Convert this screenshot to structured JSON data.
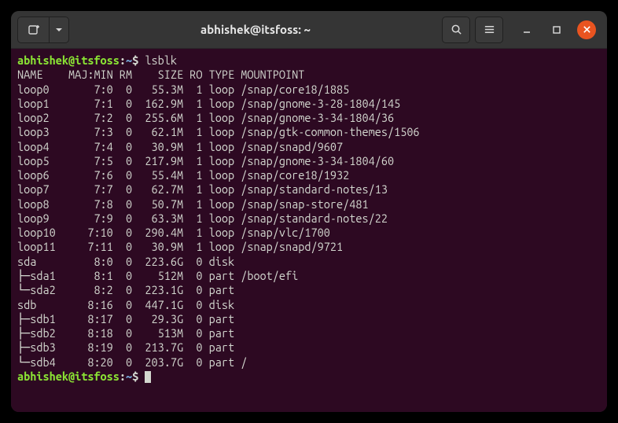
{
  "window": {
    "title": "abhishek@itsfoss: ~"
  },
  "prompt": {
    "userhost": "abhishek@itsfoss",
    "sep": ":",
    "path": "~",
    "sigil": "$"
  },
  "command": "lsblk",
  "header": {
    "name": "NAME",
    "majmin": "MAJ:MIN",
    "rm": "RM",
    "size": "SIZE",
    "ro": "RO",
    "type": "TYPE",
    "mountpoint": "MOUNTPOINT"
  },
  "rows": [
    {
      "prefix": "",
      "name": "loop0",
      "majmin": "7:0",
      "rm": "0",
      "size": "55.3M",
      "ro": "1",
      "type": "loop",
      "mountpoint": "/snap/core18/1885"
    },
    {
      "prefix": "",
      "name": "loop1",
      "majmin": "7:1",
      "rm": "0",
      "size": "162.9M",
      "ro": "1",
      "type": "loop",
      "mountpoint": "/snap/gnome-3-28-1804/145"
    },
    {
      "prefix": "",
      "name": "loop2",
      "majmin": "7:2",
      "rm": "0",
      "size": "255.6M",
      "ro": "1",
      "type": "loop",
      "mountpoint": "/snap/gnome-3-34-1804/36"
    },
    {
      "prefix": "",
      "name": "loop3",
      "majmin": "7:3",
      "rm": "0",
      "size": "62.1M",
      "ro": "1",
      "type": "loop",
      "mountpoint": "/snap/gtk-common-themes/1506"
    },
    {
      "prefix": "",
      "name": "loop4",
      "majmin": "7:4",
      "rm": "0",
      "size": "30.9M",
      "ro": "1",
      "type": "loop",
      "mountpoint": "/snap/snapd/9607"
    },
    {
      "prefix": "",
      "name": "loop5",
      "majmin": "7:5",
      "rm": "0",
      "size": "217.9M",
      "ro": "1",
      "type": "loop",
      "mountpoint": "/snap/gnome-3-34-1804/60"
    },
    {
      "prefix": "",
      "name": "loop6",
      "majmin": "7:6",
      "rm": "0",
      "size": "55.4M",
      "ro": "1",
      "type": "loop",
      "mountpoint": "/snap/core18/1932"
    },
    {
      "prefix": "",
      "name": "loop7",
      "majmin": "7:7",
      "rm": "0",
      "size": "62.7M",
      "ro": "1",
      "type": "loop",
      "mountpoint": "/snap/standard-notes/13"
    },
    {
      "prefix": "",
      "name": "loop8",
      "majmin": "7:8",
      "rm": "0",
      "size": "50.7M",
      "ro": "1",
      "type": "loop",
      "mountpoint": "/snap/snap-store/481"
    },
    {
      "prefix": "",
      "name": "loop9",
      "majmin": "7:9",
      "rm": "0",
      "size": "63.3M",
      "ro": "1",
      "type": "loop",
      "mountpoint": "/snap/standard-notes/22"
    },
    {
      "prefix": "",
      "name": "loop10",
      "majmin": "7:10",
      "rm": "0",
      "size": "290.4M",
      "ro": "1",
      "type": "loop",
      "mountpoint": "/snap/vlc/1700"
    },
    {
      "prefix": "",
      "name": "loop11",
      "majmin": "7:11",
      "rm": "0",
      "size": "30.9M",
      "ro": "1",
      "type": "loop",
      "mountpoint": "/snap/snapd/9721"
    },
    {
      "prefix": "",
      "name": "sda",
      "majmin": "8:0",
      "rm": "0",
      "size": "223.6G",
      "ro": "0",
      "type": "disk",
      "mountpoint": ""
    },
    {
      "prefix": "├─",
      "name": "sda1",
      "majmin": "8:1",
      "rm": "0",
      "size": "512M",
      "ro": "0",
      "type": "part",
      "mountpoint": "/boot/efi"
    },
    {
      "prefix": "└─",
      "name": "sda2",
      "majmin": "8:2",
      "rm": "0",
      "size": "223.1G",
      "ro": "0",
      "type": "part",
      "mountpoint": ""
    },
    {
      "prefix": "",
      "name": "sdb",
      "majmin": "8:16",
      "rm": "0",
      "size": "447.1G",
      "ro": "0",
      "type": "disk",
      "mountpoint": ""
    },
    {
      "prefix": "├─",
      "name": "sdb1",
      "majmin": "8:17",
      "rm": "0",
      "size": "29.3G",
      "ro": "0",
      "type": "part",
      "mountpoint": ""
    },
    {
      "prefix": "├─",
      "name": "sdb2",
      "majmin": "8:18",
      "rm": "0",
      "size": "513M",
      "ro": "0",
      "type": "part",
      "mountpoint": ""
    },
    {
      "prefix": "├─",
      "name": "sdb3",
      "majmin": "8:19",
      "rm": "0",
      "size": "213.7G",
      "ro": "0",
      "type": "part",
      "mountpoint": ""
    },
    {
      "prefix": "└─",
      "name": "sdb4",
      "majmin": "8:20",
      "rm": "0",
      "size": "203.7G",
      "ro": "0",
      "type": "part",
      "mountpoint": "/"
    }
  ]
}
